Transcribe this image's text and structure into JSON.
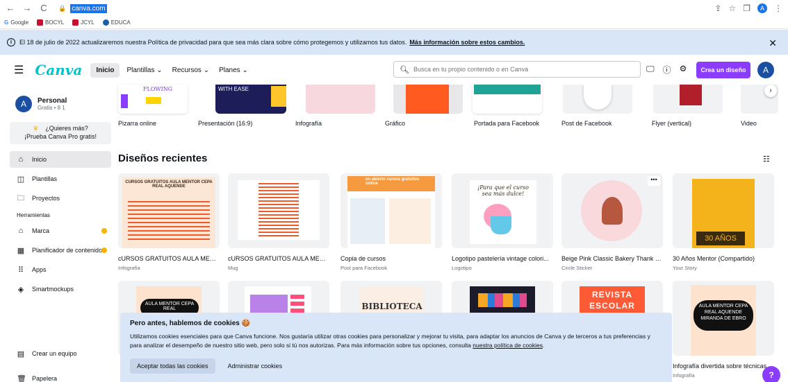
{
  "browser": {
    "url": "canva.com",
    "bookmarks": [
      "Google",
      "BOCYL",
      "JCYL",
      "EDUCA"
    ],
    "profile_initial": "A"
  },
  "privacy_banner": {
    "text": "El 18 de julio de 2022 actualizaremos nuestra Política de privacidad para que sea más clara sobre cómo protegemos y utilizamos tus datos.",
    "link": "Más información sobre estos cambios."
  },
  "header": {
    "logo": "Canva",
    "home": "Inicio",
    "menu": [
      "Plantillas",
      "Recursos",
      "Planes"
    ],
    "search_placeholder": "Busca en tu propio contenido o en Canva",
    "create_button": "Crea un diseño",
    "avatar": "A"
  },
  "sidebar": {
    "account_name": "Personal",
    "account_sub": "Gratis • 8 1",
    "avatar": "A",
    "pro_title": "¿Quieres más?",
    "pro_sub": "¡Prueba Canva Pro gratis!",
    "items": [
      "Inicio",
      "Plantillas",
      "Proyectos"
    ],
    "section": "Herramientas",
    "tools": [
      "Marca",
      "Planificador de contenido",
      "Apps",
      "Smartmockups"
    ],
    "bottom": [
      "Crear un equipo",
      "Papelera"
    ]
  },
  "templates": [
    "Pizarra online",
    "Presentación (16:9)",
    "Infografía",
    "Gráfico",
    "Portada para Facebook",
    "Post de Facebook",
    "Flyer (vertical)",
    "Video"
  ],
  "template_text": {
    "flowing": "FLOWING",
    "with_ease": "WITH EASE"
  },
  "recent": {
    "title": "Diseños recientes",
    "items": [
      {
        "title": "cURSOS GRATUITOS AULA MENTO...",
        "sub": "Infografía",
        "thumb_text": "CURSOS GRATUITOS AULA MENTOR CEPA REAL AQUENDE"
      },
      {
        "title": "cURSOS GRATUITOS AULA MENTOR",
        "sub": "Mug",
        "thumb_text": ""
      },
      {
        "title": "Copia de cursos",
        "sub": "Post para Facebook",
        "thumb_text": "en abierto cursos gratuitos online"
      },
      {
        "title": "Logotipo pastelería vintage colori...",
        "sub": "Logotipo",
        "thumb_text": "¡Para que el curso sea más dulce!"
      },
      {
        "title": "Beige Pink Classic Bakery Thank Y...",
        "sub": "Circle Sticker",
        "thumb_text": ""
      },
      {
        "title": "30 Años Mentor (Compartido)",
        "sub": "Your Story",
        "thumb_text": "30 AÑOS"
      }
    ],
    "row2": [
      {
        "thumb_text": "AULA MENTOR CEPA REAL",
        "title": "",
        "sub": ""
      },
      {
        "thumb_text": "",
        "title": "",
        "sub": ""
      },
      {
        "thumb_text": "BIBLIOTECA",
        "title": "",
        "sub": ""
      },
      {
        "thumb_text": "",
        "title": "",
        "sub": ""
      },
      {
        "thumb_text": "REVISTA ESCOLAR",
        "title": "",
        "sub": ""
      },
      {
        "thumb_text": "AULA MENTOR CEPA REAL AQUENDE MIRANDA DE EBRO",
        "title": "Infografía divertida sobre técnicas...",
        "sub": "Infografía"
      }
    ]
  },
  "cookie": {
    "title": "Pero antes, hablemos de cookies 🍪",
    "body": "Utilizamos cookies esenciales para que Canva funcione. Nos gustaría utilizar otras cookies para personalizar y mejorar tu visita, para adaptar los anuncios de Canva y de terceros a tus preferencias y para analizar el desempeño de nuestro sitio web, pero solo si tú nos autorizas. Para más información sobre tus opciones, consulta",
    "link": "nuestra política de cookies",
    "accept": "Aceptar todas las cookies",
    "manage": "Administrar cookies"
  },
  "help": "?"
}
